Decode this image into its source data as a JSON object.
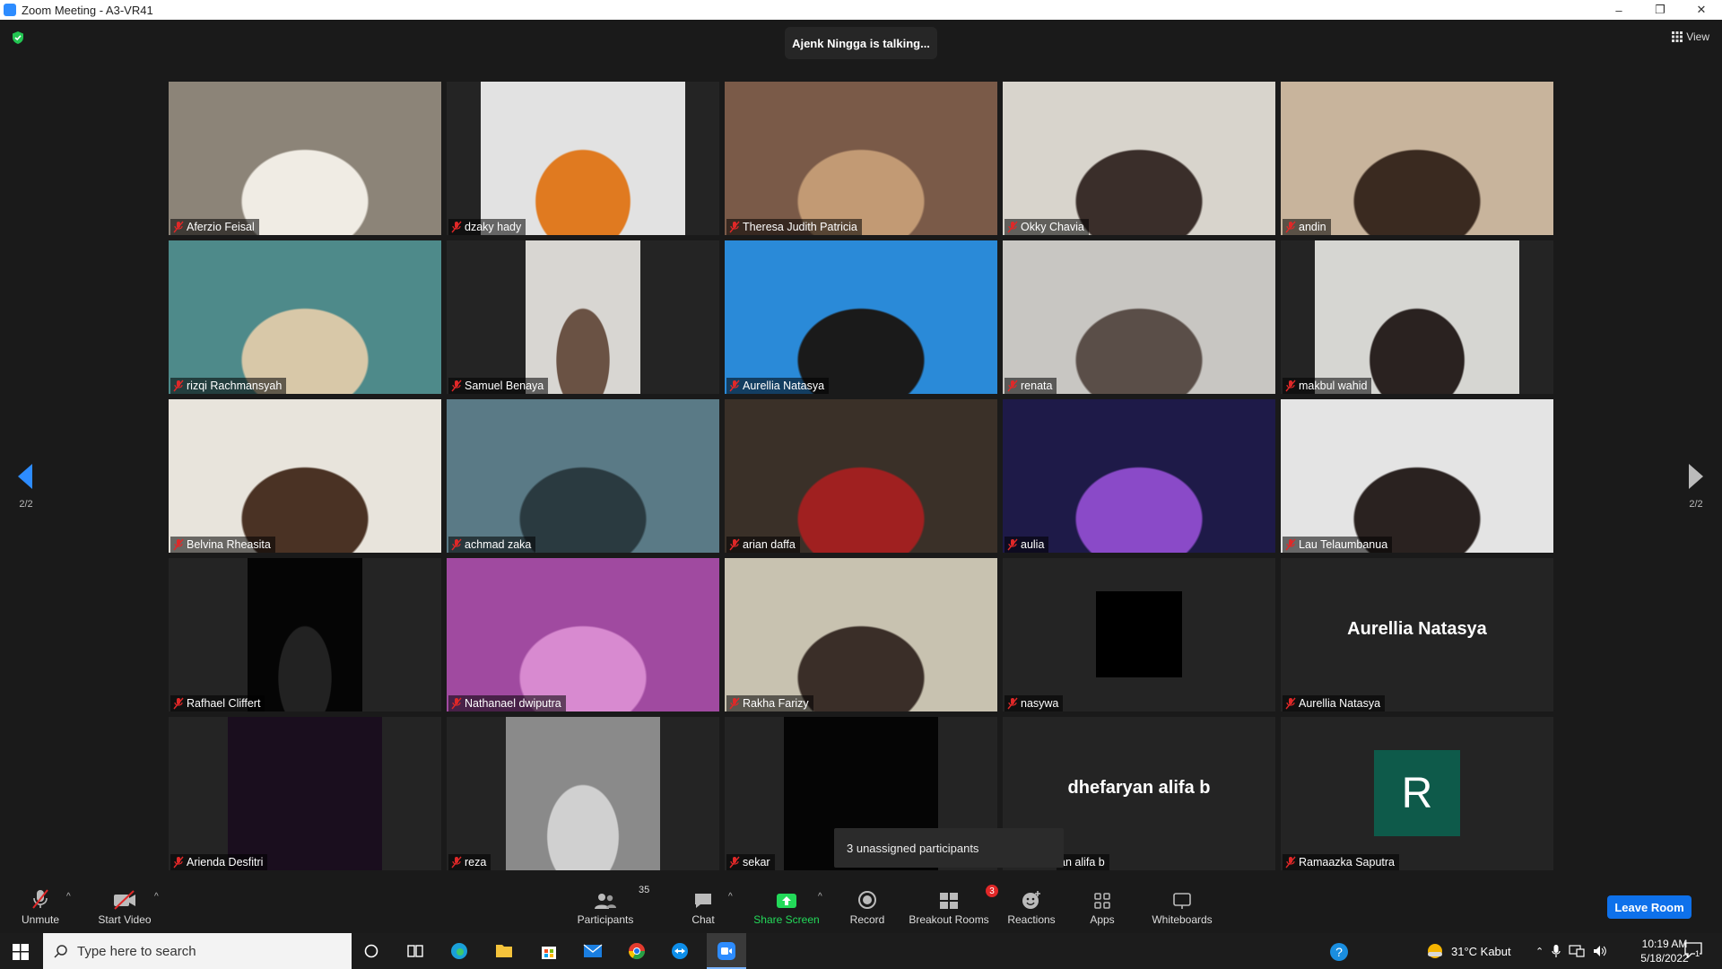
{
  "window": {
    "title": "Zoom Meeting - A3-VR41",
    "minimize": "–",
    "restore": "❐",
    "close": "✕"
  },
  "meeting": {
    "talking_banner": "Ajenk Ningga is talking...",
    "view_label": "View",
    "page_left": "2/2",
    "page_right": "2/2",
    "unassigned_tooltip": "3 unassigned participants"
  },
  "participants": [
    {
      "name": "Aferzio Feisal",
      "bg": "#8c8478",
      "fg": "#f0ece4"
    },
    {
      "name": "dzaky hady",
      "bg": "#e2e2e2",
      "fg": "#e07a20"
    },
    {
      "name": "Theresa Judith Patricia",
      "bg": "#7a5a48",
      "fg": "#c29a74"
    },
    {
      "name": "Okky Chavia",
      "bg": "#d8d4cc",
      "fg": "#3a2e2a"
    },
    {
      "name": "andin",
      "bg": "#c8b49c",
      "fg": "#3a2a20"
    },
    {
      "name": "rizqi Rachmansyah",
      "bg": "#4e8a8a",
      "fg": "#d8c8a8"
    },
    {
      "name": "Samuel Benaya",
      "bg": "#d8d6d2",
      "fg": "#6a5244"
    },
    {
      "name": "Aurellia Natasya",
      "bg": "#2a8ad8",
      "fg": "#1a1a1a"
    },
    {
      "name": "renata",
      "bg": "#c8c6c2",
      "fg": "#5a4e48"
    },
    {
      "name": "makbul wahid",
      "bg": "#d6d6d2",
      "fg": "#2a2220"
    },
    {
      "name": "Belvina Rheasita",
      "bg": "#e8e4dc",
      "fg": "#4a3224"
    },
    {
      "name": "achmad zaka",
      "bg": "#5a7a86",
      "fg": "#2a3a40"
    },
    {
      "name": "arian daffa",
      "bg": "#3a3028",
      "fg": "#a02020"
    },
    {
      "name": "aulia",
      "bg": "#1e1a48",
      "fg": "#8a4ac8"
    },
    {
      "name": "Lau Telaumbanua",
      "bg": "#e4e4e4",
      "fg": "#2a2220"
    },
    {
      "name": "Rafhael Cliffert",
      "bg": "#050505",
      "fg": "#222"
    },
    {
      "name": "Nathanael dwiputra",
      "bg": "#a04aa0",
      "fg": "#d88ad0"
    },
    {
      "name": "Rakha Farizy",
      "bg": "#c8c2b0",
      "fg": "#3a2e28"
    },
    {
      "name": "nasywa",
      "bg": "#000000",
      "fg": "#000"
    },
    {
      "name": "Aurellia Natasya",
      "bg": "#242424",
      "fg": "#242424"
    },
    {
      "name": "Arienda Desfitri",
      "bg": "#1a0e1e",
      "fg": "#1a0e1e"
    },
    {
      "name": "reza",
      "bg": "#8a8a8a",
      "fg": "#d0d0d0"
    },
    {
      "name": "sekar",
      "bg": "#050505",
      "fg": "#050505"
    },
    {
      "name": "an alifa b",
      "bg": "#242424",
      "fg": "#242424"
    },
    {
      "name": "Ramaazka Saputra",
      "bg": "#242424",
      "fg": "#242424"
    }
  ],
  "name_tiles": {
    "aurellia_big": "Aurellia Natasya",
    "dhefaryan_big": "dhefaryan alifa b",
    "avatar_letter": "R"
  },
  "toolbar": {
    "unmute": "Unmute",
    "start_video": "Start Video",
    "participants": "Participants",
    "participants_count": "35",
    "chat": "Chat",
    "share_screen": "Share Screen",
    "record": "Record",
    "breakout_rooms": "Breakout Rooms",
    "breakout_badge": "3",
    "reactions": "Reactions",
    "apps": "Apps",
    "whiteboards": "Whiteboards",
    "leave_room": "Leave Room"
  },
  "taskbar": {
    "search_placeholder": "Type here to search",
    "weather": "31°C  Kabut",
    "time": "10:19 AM",
    "date": "5/18/2022",
    "notifications": "1"
  },
  "colors": {
    "accent_blue": "#0e71eb",
    "share_green": "#23d959",
    "muted_red": "#e02828"
  }
}
